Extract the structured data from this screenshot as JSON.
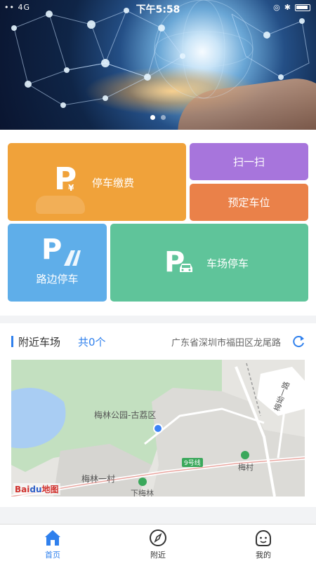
{
  "status_bar": {
    "time": "下午5:58",
    "left_text": "•• 4G",
    "right_icons": [
      "alarm-icon",
      "bluetooth-icon",
      "battery-icon"
    ]
  },
  "banner": {
    "slide_count": 2,
    "active_slide": 1
  },
  "tiles": {
    "pay": {
      "label": "停车缴费",
      "icon": "P",
      "sub_icon": "¥",
      "color": "#f0a23a"
    },
    "scan": {
      "label": "扫一扫",
      "color": "#a775dc"
    },
    "reserve": {
      "label": "预定车位",
      "color": "#ea8149"
    },
    "roadside": {
      "label": "路边停车",
      "icon": "P",
      "color": "#5faee9"
    },
    "lot": {
      "label": "车场停车",
      "icon": "P",
      "color": "#5fc49a"
    }
  },
  "nearby": {
    "title": "附近车场",
    "count": "共0个",
    "address": "广东省深圳市福田区龙尾路",
    "accent": "#2f80ed"
  },
  "map": {
    "pois": {
      "park": "梅林公园-古荔区",
      "village": "梅林一村",
      "metro1": "下梅林",
      "metro2": "梅村",
      "line": "9号线",
      "road": "梅坳一路"
    },
    "logo": {
      "bai": "Bai",
      "du": "du",
      "map": "地图"
    }
  },
  "tabbar": {
    "items": [
      {
        "label": "首页",
        "icon": "home-icon",
        "active": true
      },
      {
        "label": "附近",
        "icon": "compass-icon",
        "active": false
      },
      {
        "label": "我的",
        "icon": "profile-icon",
        "active": false
      }
    ]
  }
}
